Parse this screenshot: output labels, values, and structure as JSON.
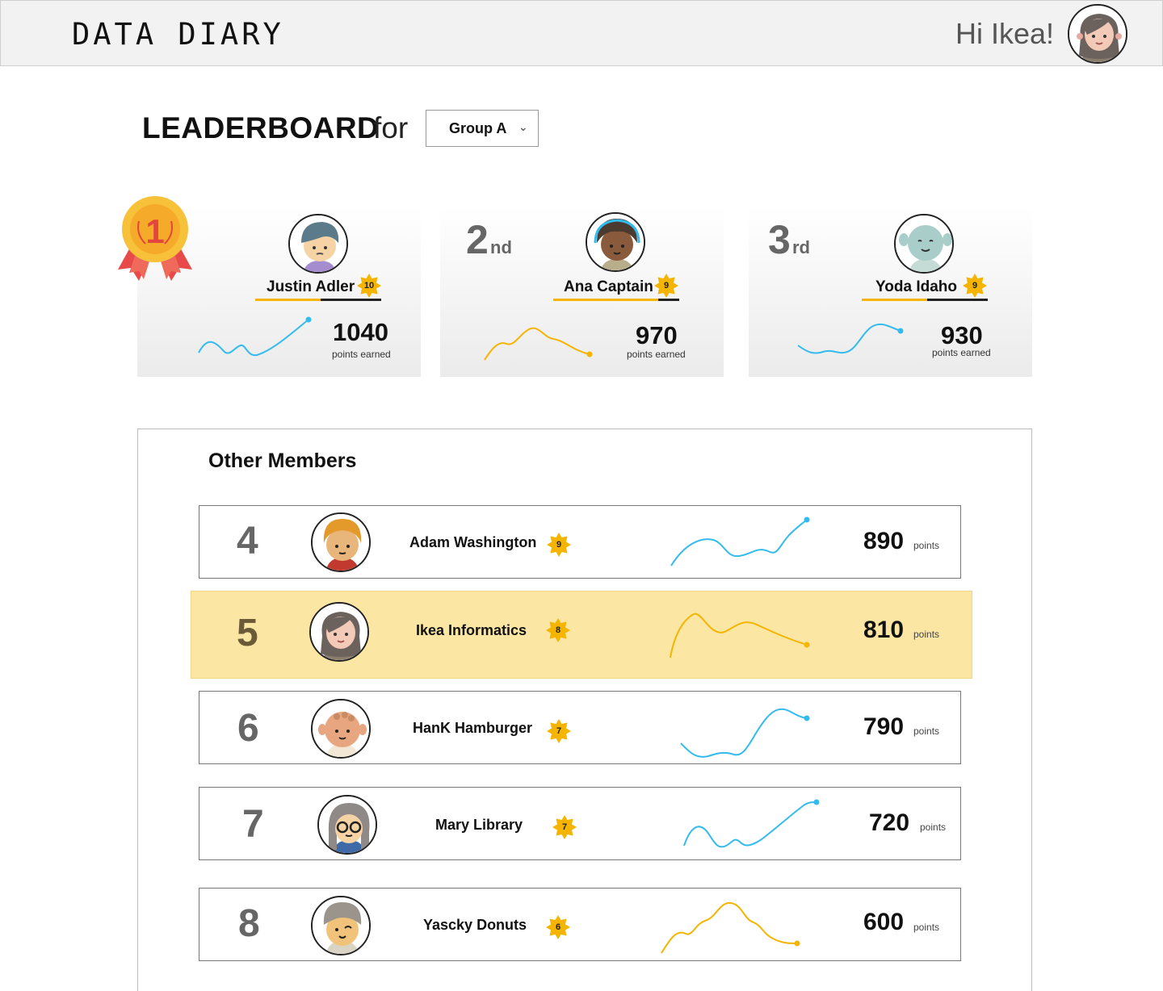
{
  "app": {
    "brand": "DATA DIARY",
    "greeting": "Hi Ikea!",
    "user_avatar_icon": "user-avatar-icon"
  },
  "heading": {
    "title": "LEADERBOARD",
    "connector": "for",
    "group": "Group A",
    "chevron_icon": "chevron-down-icon"
  },
  "colors": {
    "blue": "#33bbee",
    "gold": "#f4b400",
    "highlight": "#fce6a4",
    "medal_gold": "#f8c13a",
    "ribbon": "#e84a4a"
  },
  "medal": {
    "number": "1"
  },
  "top3": [
    {
      "place": "1",
      "suffix": "",
      "name": "Justin Adler",
      "badge": "10",
      "points": "1040",
      "points_label": "points earned",
      "trend": "blue",
      "level_fill": 0.55
    },
    {
      "place": "2",
      "suffix": "nd",
      "name": "Ana Captain",
      "badge": "9",
      "points": "970",
      "points_label": "points earned",
      "trend": "gold",
      "level_fill": 0.83
    },
    {
      "place": "3",
      "suffix": "rd",
      "name": "Yoda Idaho",
      "badge": "9",
      "points": "930",
      "points_label": "points earned",
      "trend": "blue",
      "level_fill": 0.52
    }
  ],
  "others": {
    "title": "Other Members",
    "rows": [
      {
        "rank": "4",
        "name": "Adam Washington",
        "badge": "9",
        "points": "890",
        "points_label": "points",
        "trend": "blue",
        "highlight": false
      },
      {
        "rank": "5",
        "name": "Ikea Informatics",
        "badge": "8",
        "points": "810",
        "points_label": "points",
        "trend": "gold",
        "highlight": true
      },
      {
        "rank": "6",
        "name": "HanK Hamburger",
        "badge": "7",
        "points": "790",
        "points_label": "points",
        "trend": "blue",
        "highlight": false
      },
      {
        "rank": "7",
        "name": "Mary Library",
        "badge": "7",
        "points": "720",
        "points_label": "points",
        "trend": "blue",
        "highlight": false
      },
      {
        "rank": "8",
        "name": "Yascky Donuts",
        "badge": "6",
        "points": "600",
        "points_label": "points",
        "trend": "gold",
        "highlight": false
      }
    ]
  }
}
